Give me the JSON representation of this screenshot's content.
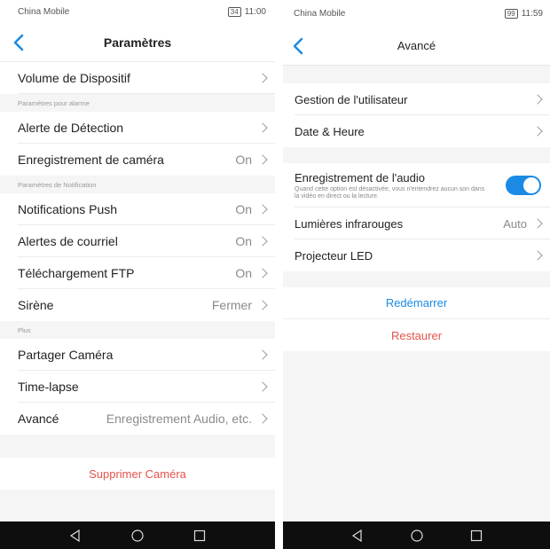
{
  "screen1": {
    "status": {
      "carrier": "China Mobile",
      "battery": "34",
      "time": "11:00"
    },
    "title": "Paramètres",
    "device_volume": "Volume de Dispositif",
    "section_alarm": "Paramètres pour alarme",
    "detection_alert": "Alerte de Détection",
    "camera_recording": {
      "label": "Enregistrement de caméra",
      "value": "On"
    },
    "section_notification": "Paramètres de Notification",
    "push": {
      "label": "Notifications Push",
      "value": "On"
    },
    "email": {
      "label": "Alertes de courriel",
      "value": "On"
    },
    "ftp": {
      "label": "Téléchargement FTP",
      "value": "On"
    },
    "siren": {
      "label": "Sirène",
      "value": "Fermer"
    },
    "section_more": "Plus",
    "share": "Partager Caméra",
    "timelapse": "Time-lapse",
    "advanced": {
      "label": "Avancé",
      "value": "Enregistrement Audio, etc."
    },
    "delete": "Supprimer Caméra"
  },
  "screen2": {
    "status": {
      "carrier": "China Mobile",
      "battery": "99",
      "time": "11:59"
    },
    "title": "Avancé",
    "user_mgmt": "Gestion de l'utilisateur",
    "datetime": "Date & Heure",
    "audio": {
      "label": "Enregistrement de l'audio",
      "desc": "Quand cette option est désactivée, vous n'entendrez aucun son dans la vidéo en direct ou la lecture.",
      "enabled": true
    },
    "infrared": {
      "label": "Lumières infrarouges",
      "value": "Auto"
    },
    "led": "Projecteur LED",
    "restart": "Redémarrer",
    "restore": "Restaurer"
  },
  "colors": {
    "accent": "#1a8ae5",
    "danger": "#e5534b",
    "restart": "#1a8ae5",
    "background": "#f5f5f6"
  },
  "icons": [
    "back-icon",
    "chevron-right-icon",
    "nav-back-icon",
    "nav-home-icon",
    "nav-recents-icon"
  ]
}
